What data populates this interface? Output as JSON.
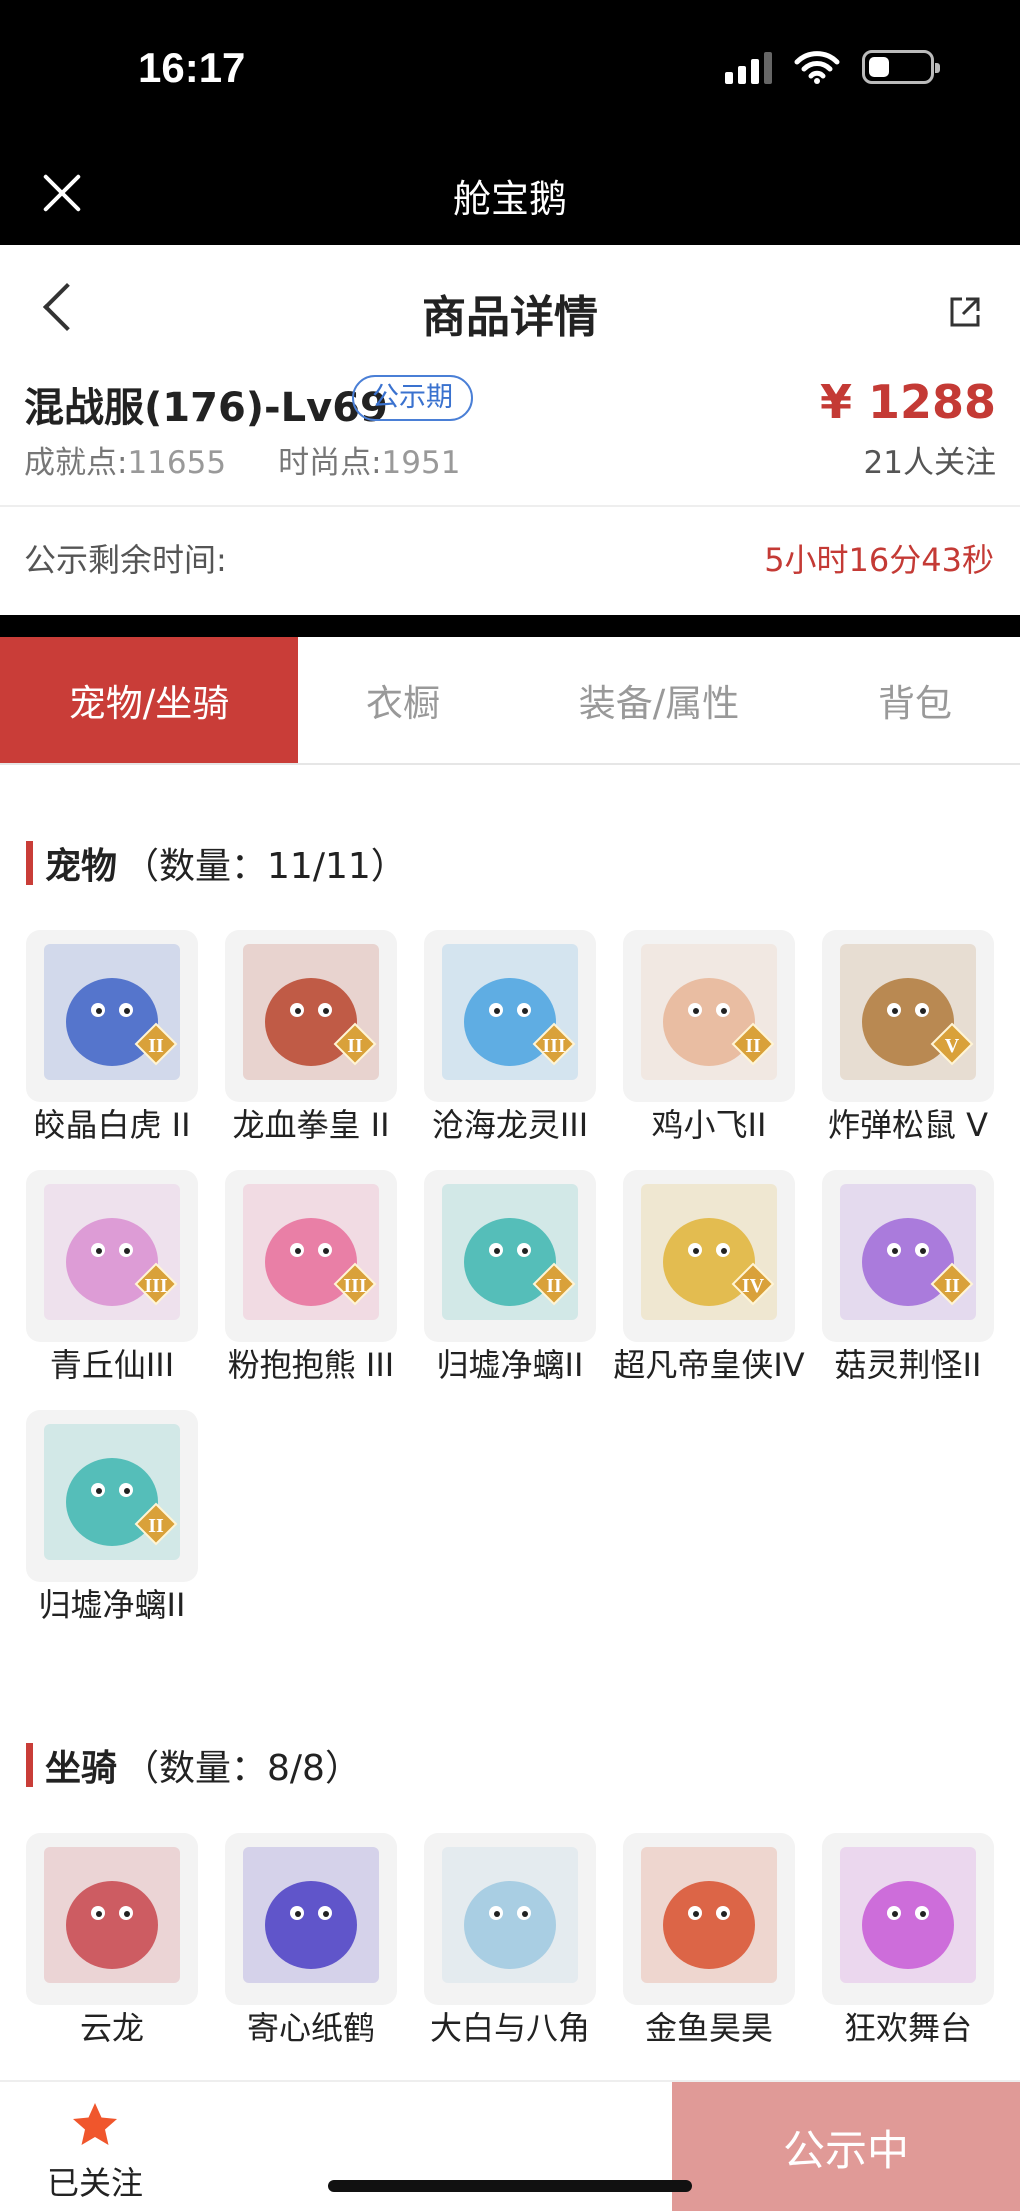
{
  "status_bar": {
    "time": "16:17",
    "battery_level": 0.35
  },
  "app_bar": {
    "title": "舱宝鹅"
  },
  "page": {
    "title": "商品详情"
  },
  "product": {
    "name": "混战服(176)-Lv69",
    "badge": "公示期",
    "achievement_label": "成就点:",
    "achievement_value": "11655",
    "fashion_label": "时尚点:",
    "fashion_value": "1951",
    "price": "¥ 1288",
    "followers": "21人关注"
  },
  "countdown": {
    "label": "公示剩余时间:",
    "value": "5小时16分43秒"
  },
  "tabs": [
    {
      "label": "宠物/坐骑",
      "active": true
    },
    {
      "label": "衣橱",
      "active": false
    },
    {
      "label": "装备/属性",
      "active": false
    },
    {
      "label": "背包",
      "active": false
    }
  ],
  "pets_section": {
    "title": "宠物",
    "count": "（数量：11/11）",
    "items": [
      {
        "name": "皎晶白虎 II",
        "color": "#3f63c7",
        "tier": "II"
      },
      {
        "name": "龙血拳皇 II",
        "color": "#b8452e",
        "tier": "II"
      },
      {
        "name": "沧海龙灵III",
        "color": "#4aa3e0",
        "tier": "III"
      },
      {
        "name": "鸡小飞II",
        "color": "#e8b597",
        "tier": "II"
      },
      {
        "name": "炸弹松鼠 V",
        "color": "#b07a3c",
        "tier": "V"
      },
      {
        "name": "青丘仙III",
        "color": "#d98fd1",
        "tier": "III"
      },
      {
        "name": "粉抱抱熊 III",
        "color": "#e86f9b",
        "tier": "III"
      },
      {
        "name": "归墟净螭II",
        "color": "#3fb6b0",
        "tier": "II"
      },
      {
        "name": "超凡帝皇侠IV",
        "color": "#e0b43a",
        "tier": "IV"
      },
      {
        "name": "菇灵荆怪II",
        "color": "#a06ad8",
        "tier": "II"
      },
      {
        "name": "归墟净螭II",
        "color": "#3fb6b0",
        "tier": "II"
      }
    ]
  },
  "mounts_section": {
    "title": "坐骑",
    "count": "（数量：8/8）",
    "items": [
      {
        "name": "云龙",
        "color": "#c8474e"
      },
      {
        "name": "寄心纸鹤",
        "color": "#4b3fc4"
      },
      {
        "name": "大白与八角",
        "color": "#9fc9e0"
      },
      {
        "name": "金鱼昊昊",
        "color": "#d8512f"
      },
      {
        "name": "狂欢舞台",
        "color": "#c85bd6"
      }
    ]
  },
  "bottom_bar": {
    "follow_label": "已关注",
    "status_label": "公示中"
  },
  "colors": {
    "accent": "#c93d38",
    "price": "#c43a35",
    "badge": "#3a72cf",
    "star": "#f0562c"
  },
  "icons": [
    "close-icon",
    "back-icon",
    "share-icon",
    "star-icon",
    "tier-badge-icon"
  ]
}
